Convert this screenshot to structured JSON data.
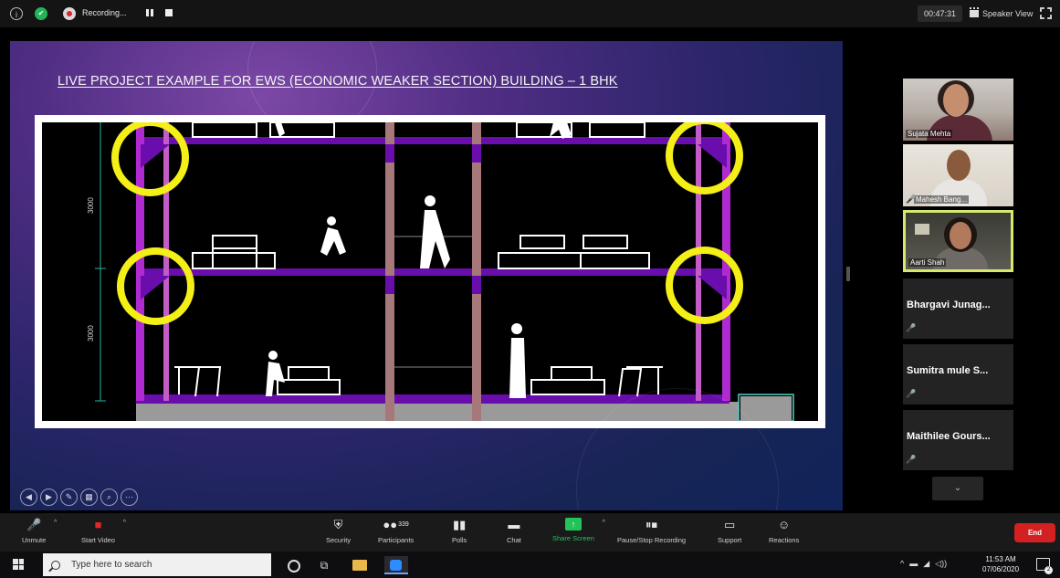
{
  "topbar": {
    "recording_label": "Recording...",
    "timer": "00:47:31",
    "view_label": "Speaker View"
  },
  "slide": {
    "title": "LIVE PROJECT EXAMPLE FOR EWS (ECONOMIC WEAKER SECTION) BUILDING – 1 BHK",
    "dimensions": [
      "3000",
      "3000"
    ],
    "annotation_color": "#f4ef17",
    "slab_color": "#6a0dad"
  },
  "participants": {
    "video_tiles": [
      {
        "name": "Sujata Mehta",
        "muted": false
      },
      {
        "name": "Mahesh Bang...",
        "muted": true
      },
      {
        "name": "Aarti Shah",
        "muted": false,
        "active_speaker": true
      }
    ],
    "name_tiles": [
      {
        "name": "Bhargavi  Junag...",
        "muted": true
      },
      {
        "name": "Sumitra  mule S...",
        "muted": true
      },
      {
        "name": "Maithilee  Gours...",
        "muted": true
      }
    ]
  },
  "controls": {
    "unmute": "Unmute",
    "start_video": "Start Video",
    "security": "Security",
    "participants": "Participants",
    "participant_count": "339",
    "polls": "Polls",
    "chat": "Chat",
    "share_screen": "Share Screen",
    "pause_stop_recording": "Pause/Stop Recording",
    "support": "Support",
    "reactions": "Reactions",
    "end": "End"
  },
  "taskbar": {
    "search_placeholder": "Type here to search",
    "time": "11:53 AM",
    "date": "07/06/2020",
    "notification_count": "2"
  },
  "colors": {
    "share_green": "#23c35a",
    "end_red": "#d32121",
    "active_speaker_border": "#d8e86a"
  }
}
